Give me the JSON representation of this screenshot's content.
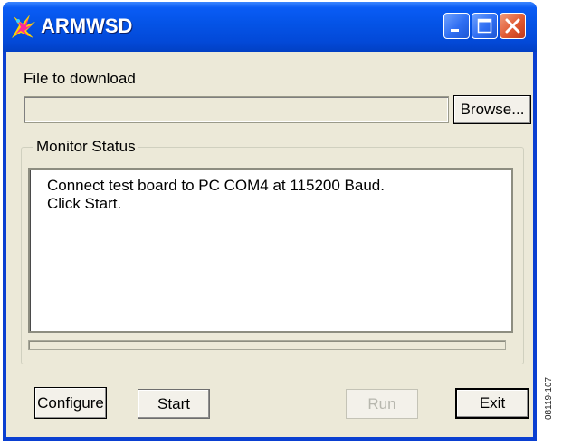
{
  "window": {
    "title": "ARMWSD",
    "controls": {
      "minimize": "minimize",
      "maximize": "maximize",
      "close": "close"
    }
  },
  "file_section": {
    "label": "File to download",
    "file_value": "",
    "browse_label": "Browse..."
  },
  "monitor": {
    "group_label": "Monitor Status",
    "lines": [
      "Connect test board to PC COM4 at 115200 Baud.",
      "Click Start."
    ],
    "progress": 0
  },
  "buttons": {
    "configure": "Configure",
    "start": "Start",
    "run": "Run",
    "exit": "Exit"
  },
  "figure_tag": "08119-107",
  "colors": {
    "titlebar": "#0453e6",
    "window_bg": "#ece9d8",
    "close_button": "#e05a32"
  }
}
